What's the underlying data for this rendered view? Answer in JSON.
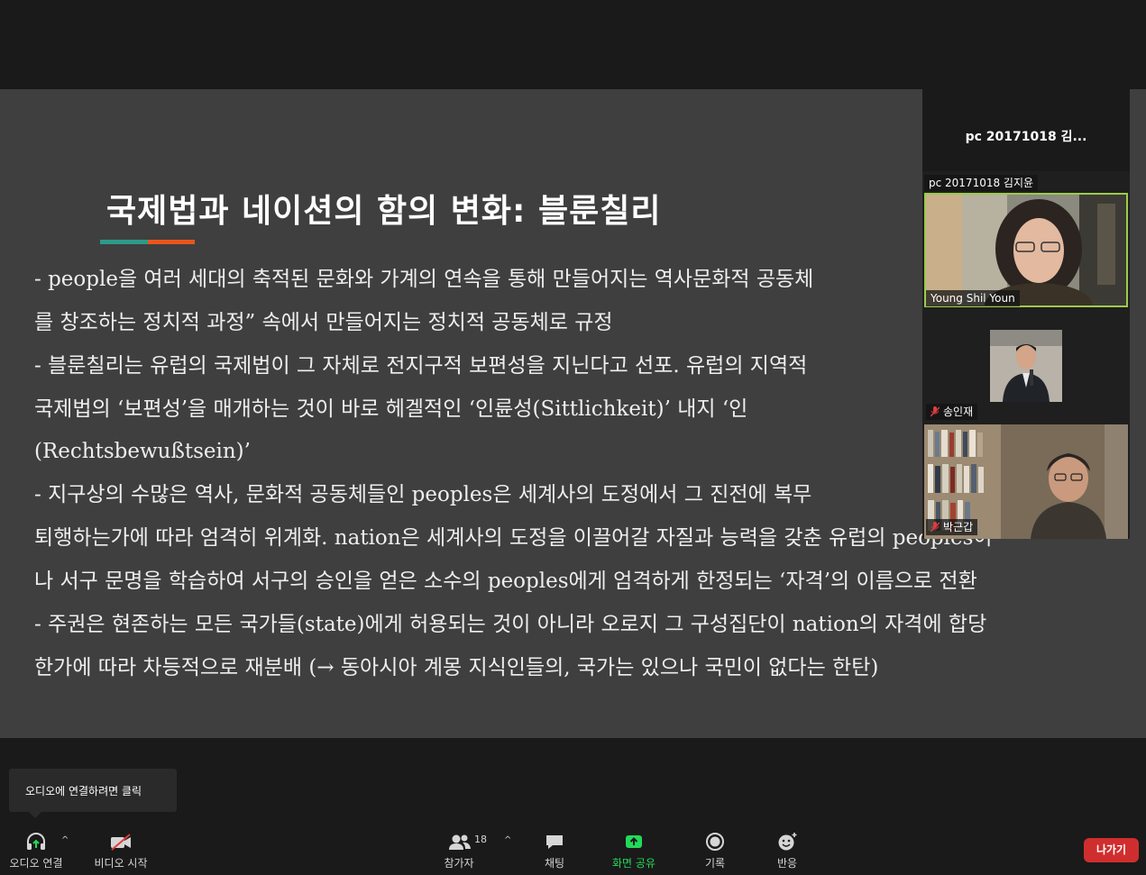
{
  "slide": {
    "title": "국제법과 네이션의 함의 변화: 블룬칠리",
    "lines": [
      "- people을 여러 세대의 축적된 문화와 가계의 연속을 통해 만들어지는 역사문화적 공동체",
      "를 창조하는 정치적 과정” 속에서 만들어지는 정치적 공동체로 규정",
      "-  블룬칠리는 유럽의 국제법이 그 자체로 전지구적 보편성을 지닌다고 선포. 유럽의 지역적",
      "국제법의 ‘보편성’을  매개하는  것이  바로  헤겔적인 ‘인륜성(Sittlichkeit)’ 내지 ‘인",
      "(Rechtsbewußtsein)’",
      "- 지구상의 수많은 역사, 문화적 공동체들인 peoples은 세계사의 도정에서 그 진전에 복무",
      "퇴행하는가에 따라 엄격히 위계화. nation은 세계사의 도정을 이끌어갈 자질과 능력을 갖춘 유럽의 peoples이",
      "나 서구 문명을 학습하여 서구의 승인을 얻은 소수의 peoples에게 엄격하게 한정되는 ‘자격’의 이름으로 전환",
      "- 주권은 현존하는 모든 국가들(state)에게 허용되는 것이 아니라 오로지 그 구성집단이 nation의 자격에 합당",
      "한가에 따라 차등적으로 재분배  (→ 동아시아 계몽 지식인들의, 국가는 있으나 국민이 없다는 한탄)"
    ]
  },
  "participants_panel": {
    "header_name": "pc 20171018 김...",
    "tiles": [
      {
        "top_label": "pc 20171018 김지윤",
        "bottom_label": "Young Shil Youn"
      },
      {
        "bottom_label": "송인재",
        "muted": true
      },
      {
        "bottom_label": "박근갑",
        "muted": true
      }
    ]
  },
  "tooltip": {
    "text": "오디오에 연결하려면 클릭"
  },
  "toolbar": {
    "audio_label": "오디오 연결",
    "video_label": "비디오 시작",
    "participants_label": "참가자",
    "participants_count": "18",
    "chat_label": "채팅",
    "share_label": "화면 공유",
    "record_label": "기록",
    "reactions_label": "반응",
    "leave_label": "나가기"
  },
  "colors": {
    "accent_teal": "#2d9a8a",
    "accent_orange": "#e8561c",
    "share_green": "#23d959",
    "leave_red": "#d02e2e",
    "active_speaker_border": "#9ccb4c"
  },
  "icons": [
    "headphones-icon",
    "video-off-icon",
    "participants-icon",
    "chat-icon",
    "share-screen-icon",
    "record-icon",
    "reactions-icon",
    "mic-muted-icon"
  ]
}
